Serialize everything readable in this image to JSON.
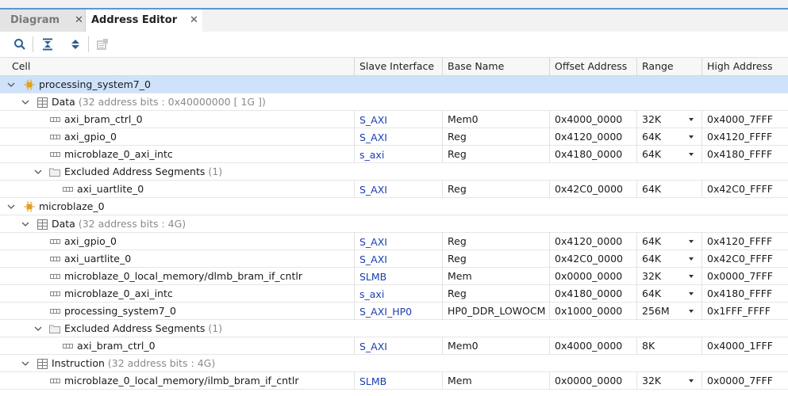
{
  "tabs": [
    {
      "label": "Diagram",
      "active": false
    },
    {
      "label": "Address Editor",
      "active": true
    }
  ],
  "toolbar": {
    "icons": [
      "search-icon",
      "collapse-all-icon",
      "expand-all-icon",
      "auto-assign-icon"
    ]
  },
  "columns": {
    "cell": "Cell",
    "slave": "Slave Interface",
    "base": "Base Name",
    "offset": "Offset Address",
    "range": "Range",
    "high": "High Address"
  },
  "colors": {
    "accent": "#5b95d6",
    "selection": "#cfe2fb",
    "link": "#1a3fb0",
    "cpu_icon": "#e0a020"
  },
  "rows": [
    {
      "kind": "processor",
      "name": "processing_system7_0",
      "selected": true,
      "expanded": true
    },
    {
      "kind": "space",
      "name": "Data",
      "meta": "(32 address bits : 0x40000000 [ 1G ])",
      "expanded": true
    },
    {
      "kind": "seg",
      "name": "axi_bram_ctrl_0",
      "slave": "S_AXI",
      "base": "Mem0",
      "offset": "0x4000_0000",
      "range": "32K",
      "high": "0x4000_7FFF"
    },
    {
      "kind": "seg",
      "name": "axi_gpio_0",
      "slave": "S_AXI",
      "base": "Reg",
      "offset": "0x4120_0000",
      "range": "64K",
      "high": "0x4120_FFFF"
    },
    {
      "kind": "seg",
      "name": "microblaze_0_axi_intc",
      "slave": "s_axi",
      "base": "Reg",
      "offset": "0x4180_0000",
      "range": "64K",
      "high": "0x4180_FFFF"
    },
    {
      "kind": "excluded",
      "name": "Excluded Address Segments",
      "meta": "(1)",
      "expanded": true
    },
    {
      "kind": "exseg",
      "name": "axi_uartlite_0",
      "slave": "S_AXI",
      "base": "Reg",
      "offset": "0x42C0_0000",
      "range": "64K",
      "high": "0x42C0_FFFF"
    },
    {
      "kind": "processor",
      "name": "microblaze_0",
      "expanded": true
    },
    {
      "kind": "space",
      "name": "Data",
      "meta": "(32 address bits : 4G)",
      "expanded": true
    },
    {
      "kind": "seg",
      "name": "axi_gpio_0",
      "slave": "S_AXI",
      "base": "Reg",
      "offset": "0x4120_0000",
      "range": "64K",
      "high": "0x4120_FFFF"
    },
    {
      "kind": "seg",
      "name": "axi_uartlite_0",
      "slave": "S_AXI",
      "base": "Reg",
      "offset": "0x42C0_0000",
      "range": "64K",
      "high": "0x42C0_FFFF"
    },
    {
      "kind": "seg",
      "name": "microblaze_0_local_memory/dlmb_bram_if_cntlr",
      "slave": "SLMB",
      "base": "Mem",
      "offset": "0x0000_0000",
      "range": "32K",
      "high": "0x0000_7FFF"
    },
    {
      "kind": "seg",
      "name": "microblaze_0_axi_intc",
      "slave": "s_axi",
      "base": "Reg",
      "offset": "0x4180_0000",
      "range": "64K",
      "high": "0x4180_FFFF"
    },
    {
      "kind": "seg",
      "name": "processing_system7_0",
      "slave": "S_AXI_HP0",
      "base": "HP0_DDR_LOWOCM",
      "offset": "0x1000_0000",
      "range": "256M",
      "high": "0x1FFF_FFFF"
    },
    {
      "kind": "excluded",
      "name": "Excluded Address Segments",
      "meta": "(1)",
      "expanded": true
    },
    {
      "kind": "exseg",
      "name": "axi_bram_ctrl_0",
      "slave": "S_AXI",
      "base": "Mem0",
      "offset": "0x4000_0000",
      "range": "8K",
      "high": "0x4000_1FFF"
    },
    {
      "kind": "space",
      "name": "Instruction",
      "meta": "(32 address bits : 4G)",
      "expanded": true
    },
    {
      "kind": "seg",
      "name": "microblaze_0_local_memory/ilmb_bram_if_cntlr",
      "slave": "SLMB",
      "base": "Mem",
      "offset": "0x0000_0000",
      "range": "32K",
      "high": "0x0000_7FFF"
    }
  ]
}
